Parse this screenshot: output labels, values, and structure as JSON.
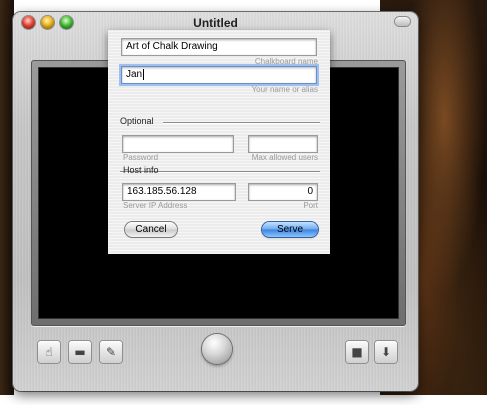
{
  "window": {
    "title": "Untitled"
  },
  "dialog": {
    "chalkboard_name": {
      "value": "Art of Chalk Drawing",
      "hint": "Chalkboard name"
    },
    "user_name": {
      "value": "Jan",
      "hint": "Your name or alias"
    },
    "optional_section": "Optional",
    "password": {
      "value": "",
      "hint": "Password"
    },
    "max_users": {
      "value": "",
      "hint": "Max allowed users"
    },
    "host_section": "Host info",
    "server_ip": {
      "value": "163.185.56.128",
      "hint": "Server IP Address"
    },
    "port": {
      "value": "0",
      "hint": "Port"
    },
    "cancel_label": "Cancel",
    "serve_label": "Serve"
  },
  "toolbar": {
    "tools": [
      {
        "icon": "hand-icon",
        "glyph": "☝"
      },
      {
        "icon": "eraser-icon",
        "glyph": "▬"
      },
      {
        "icon": "pencil-icon",
        "glyph": "✎"
      }
    ],
    "right_tools": [
      {
        "icon": "camera-icon",
        "glyph": "■"
      },
      {
        "icon": "download-arrow-icon",
        "glyph": "⬇"
      }
    ]
  },
  "colors": {
    "board": "#000000",
    "serve_button": "#3c82dc"
  }
}
